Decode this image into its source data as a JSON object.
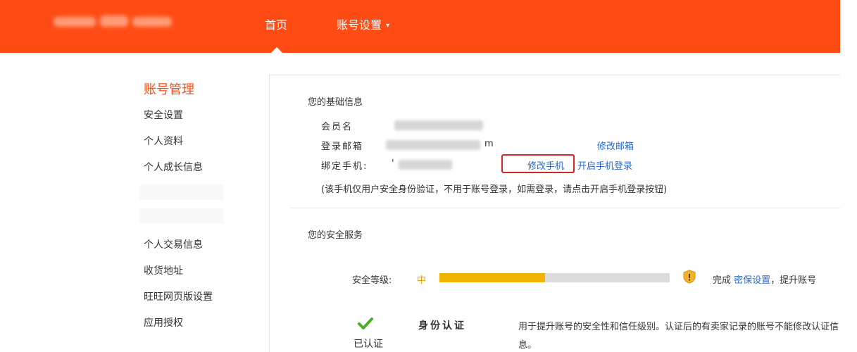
{
  "header": {
    "nav": [
      {
        "label": "首页"
      },
      {
        "label": "账号设置",
        "caret": "▾"
      }
    ]
  },
  "sidebar": {
    "title": "账号管理",
    "group1": [
      "安全设置",
      "个人资料",
      "个人成长信息"
    ],
    "group2": [
      "个人交易信息",
      "收货地址",
      "旺旺网页版设置",
      "应用授权"
    ]
  },
  "basic_info": {
    "title": "您的基础信息",
    "member_label": "会员名",
    "email_label": "登录邮箱",
    "email_suffix": "m",
    "phone_label": "绑定手机:",
    "phone_prefix": "'",
    "change_email": "修改邮箱",
    "change_phone": "修改手机",
    "enable_phone_login": "开启手机登录",
    "note": "(该手机仅用户安全身份验证，不用于账号登录，如需登录，请点击开启手机登录按钮)"
  },
  "security": {
    "title": "您的安全服务",
    "level_label": "安全等级:",
    "level_value": "中",
    "level_progress": 0.46,
    "complete_prefix": "完成",
    "complete_link": "密保设置",
    "complete_suffix": "，提升账号",
    "id_status": "已认证",
    "id_title": "身份认证",
    "id_desc": "用于提升账号的安全性和信任级别。认证后的有卖家记录的账号不能修改认证信息。"
  },
  "colors": {
    "brand": "#ff4c14",
    "link": "#2a6acb",
    "progress": "#f0b400",
    "highlight": "#d62323"
  },
  "icons": [
    "shield-warning-icon",
    "check-icon",
    "chevron-down-icon"
  ]
}
